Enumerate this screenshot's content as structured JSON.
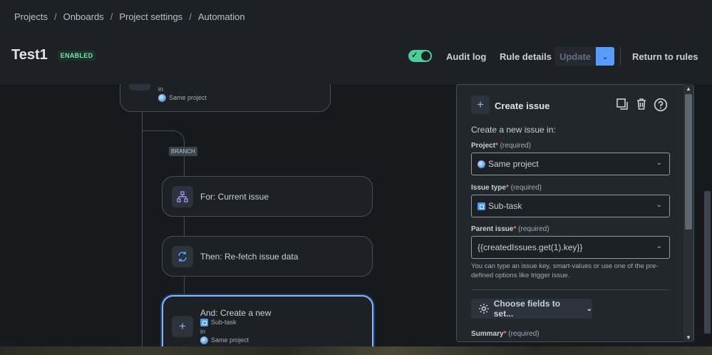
{
  "breadcrumb": [
    "Projects",
    "Onboards",
    "Project settings",
    "Automation"
  ],
  "header": {
    "title": "Test1",
    "status_badge": "ENABLED",
    "audit_log": "Audit log",
    "rule_details": "Rule details",
    "update": "Update",
    "return_to_rules": "Return to rules"
  },
  "flow": {
    "top_card_in": "in",
    "top_card_project": "Same project",
    "branch_tag": "BRANCH",
    "for_card": "For: Current issue",
    "then_card": "Then: Re-fetch issue data",
    "and_card": "And: Create a new",
    "and_card_type": "Sub-task",
    "and_card_in": "in",
    "and_card_project": "Same project"
  },
  "panel": {
    "title": "Create issue",
    "intro": "Create a new issue in:",
    "project_label": "Project",
    "project_value": "Same project",
    "issue_type_label": "Issue type",
    "issue_type_value": "Sub-task",
    "parent_label": "Parent issue",
    "parent_value": "{{createdIssues.get(1).key}}",
    "required": "(required)",
    "help_text": "You can type an issue key, smart-values or use one of the pre-defined options like trigger issue.",
    "choose_fields": "Choose fields to set...",
    "summary_label": "Summary"
  },
  "colors": {
    "accent": "#579dff",
    "enabled": "#4bce97",
    "focus_border": "#85b8ff"
  }
}
